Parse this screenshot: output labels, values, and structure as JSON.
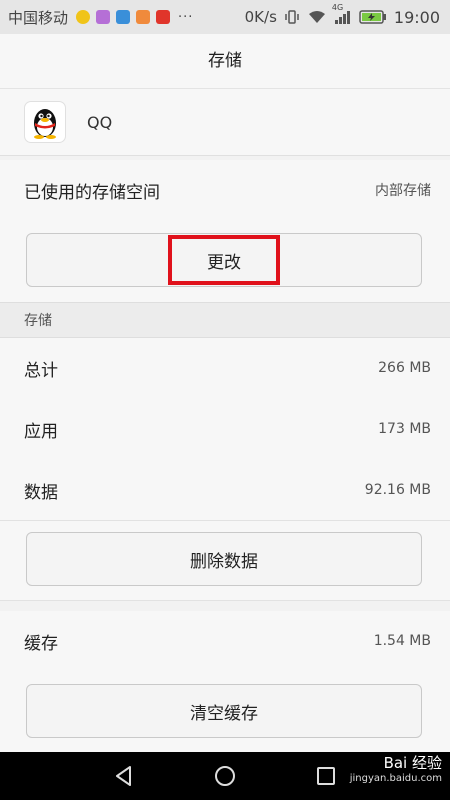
{
  "status_bar": {
    "carrier": "中国移动",
    "more": "···",
    "speed": "0K/s",
    "network": "4G",
    "time": "19:00"
  },
  "header": {
    "title": "存储"
  },
  "app": {
    "name": "QQ",
    "icon": "qq-penguin-icon"
  },
  "storage_location": {
    "label": "已使用的存储空间",
    "value": "内部存储",
    "change_button": "更改"
  },
  "storage": {
    "section_title": "存储",
    "rows": [
      {
        "label": "总计",
        "value": "266 MB"
      },
      {
        "label": "应用",
        "value": "173 MB"
      },
      {
        "label": "数据",
        "value": "92.16 MB"
      }
    ],
    "clear_data_button": "删除数据"
  },
  "cache": {
    "label": "缓存",
    "value": "1.54 MB",
    "clear_cache_button": "清空缓存"
  },
  "watermark": {
    "brand": "Bai 经验",
    "url": "jingyan.baidu.com"
  }
}
